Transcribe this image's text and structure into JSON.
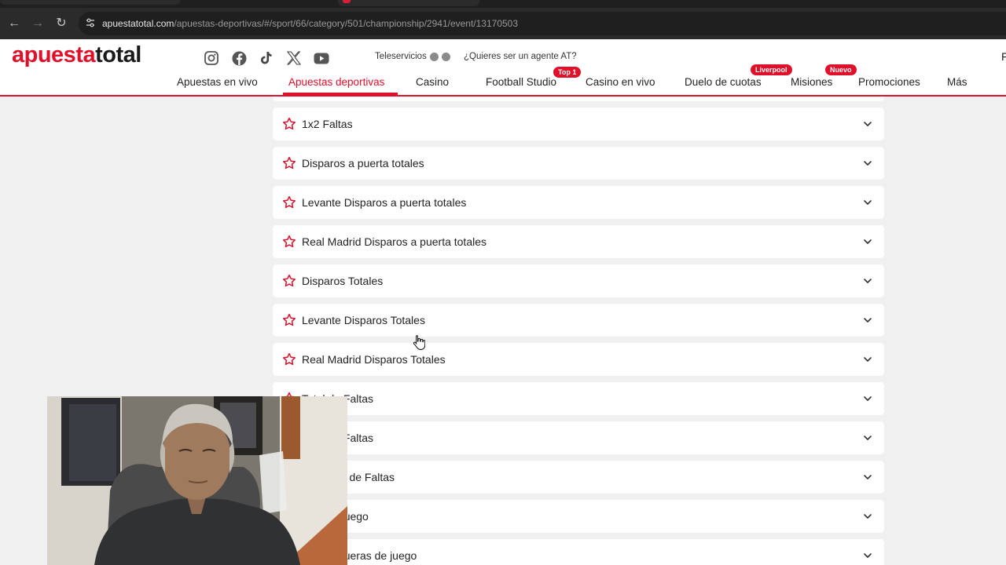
{
  "browser": {
    "url_host": "apuestatotal.com",
    "url_path": "/apuestas-deportivas/#/sport/66/category/501/championship/2941/event/13170503"
  },
  "header": {
    "logo_left": "apuesta",
    "logo_right": "total",
    "social_icons": [
      "instagram-icon",
      "facebook-icon",
      "tiktok-icon",
      "x-icon",
      "youtube-icon"
    ],
    "teleservicios": "Teleservicios",
    "agente": "¿Quieres ser un agente AT?",
    "cut_letter": "F",
    "nav": [
      {
        "label": "Apuestas en vivo"
      },
      {
        "label": "Apuestas deportivas",
        "active": true
      },
      {
        "label": "Casino"
      },
      {
        "label": "Football Studio",
        "badge": "Top 1"
      },
      {
        "label": "Casino en vivo"
      },
      {
        "label": "Duelo de cuotas",
        "badge": "Liverpool"
      },
      {
        "label": "Misiones",
        "badge": "Nuevo"
      },
      {
        "label": "Promociones"
      },
      {
        "label": "Más"
      }
    ]
  },
  "markets": [
    "1x2 Faltas",
    "Disparos a puerta totales",
    "Levante Disparos a puerta totales",
    "Real Madrid Disparos a puerta totales",
    "Disparos Totales",
    "Levante Disparos Totales",
    "Real Madrid Disparos Totales",
    "Total de Faltas",
    "Total de Faltas",
    "drid Total de Faltas",
    "eras de juego",
    "total de fueras de juego"
  ],
  "colors": {
    "brand": "#e0102a",
    "page_bg": "#f0f0f0"
  }
}
